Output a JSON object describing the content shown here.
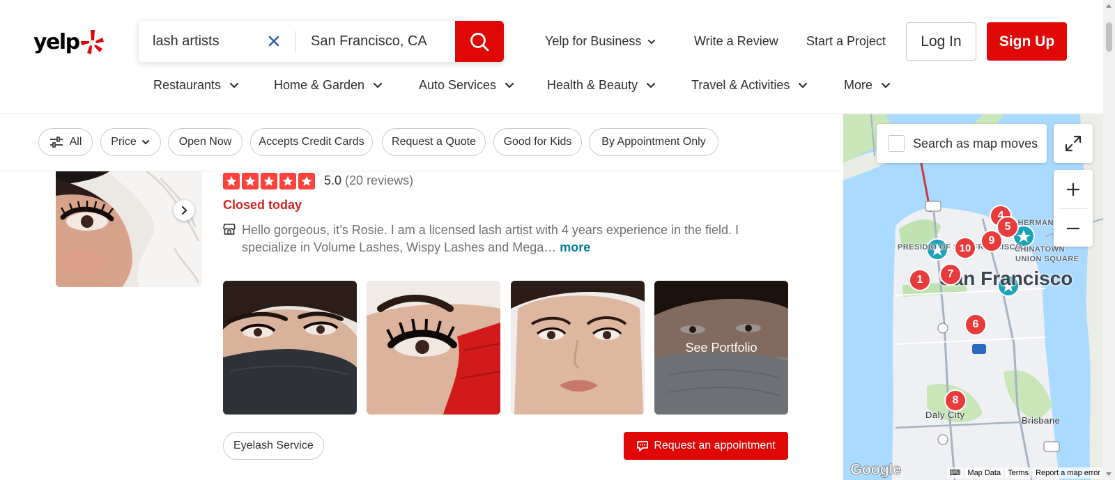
{
  "brand": {
    "logo_text": "yelp",
    "accent_color": "#e00707"
  },
  "search": {
    "find_value": "lash artists",
    "near_value": "San Francisco, CA",
    "clear_icon": "close-icon",
    "submit_icon": "search-icon"
  },
  "topnav": {
    "business": "Yelp for Business",
    "write_review": "Write a Review",
    "start_project": "Start a Project",
    "login": "Log In",
    "signup": "Sign Up"
  },
  "categories": [
    {
      "label": "Restaurants"
    },
    {
      "label": "Home & Garden"
    },
    {
      "label": "Auto Services"
    },
    {
      "label": "Health & Beauty"
    },
    {
      "label": "Travel & Activities"
    },
    {
      "label": "More"
    }
  ],
  "filters": {
    "all": "All",
    "price": "Price",
    "open_now": "Open Now",
    "accepts_credit": "Accepts Credit Cards",
    "request_quote": "Request a Quote",
    "good_for_kids": "Good for Kids",
    "by_appointment": "By Appointment Only"
  },
  "result": {
    "rating": "5.0",
    "review_count": "(20 reviews)",
    "stars": 5,
    "status": "Closed today",
    "snippet": "Hello gorgeous, it’s Rosie. I am a licensed lash artist with 4 years experience in the field. I specialize in Volume Lashes, Wispy Lashes and Mega…",
    "more_link": "more",
    "see_portfolio": "See Portfolio",
    "tag": "Eyelash Service",
    "request_appointment": "Request an appointment",
    "star_color": "#fb433c",
    "status_color": "#d32323"
  },
  "map": {
    "search_as_moves": "Search as map moves",
    "city_label": "San Francisco",
    "labels": {
      "presidio": "PRESIDIO OF SAN FRANCISCO",
      "chinatown": "CHINATOWN",
      "union_square": "UNION SQUARE",
      "fishermans": "FISHERMAN'S",
      "daly_city": "Daly City",
      "brisbane": "Brisbane"
    },
    "markers": [
      "1",
      "4",
      "5",
      "6",
      "7",
      "8",
      "9",
      "10"
    ],
    "footer": {
      "google": "Google",
      "map_data": "Map Data",
      "terms": "Terms",
      "report": "Report a map error"
    }
  }
}
